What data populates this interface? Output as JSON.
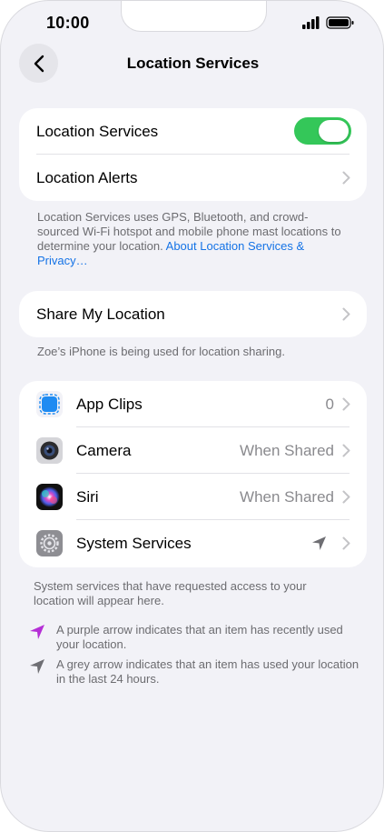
{
  "status_bar": {
    "time": "10:00"
  },
  "nav": {
    "title": "Location Services",
    "back_icon": "chevron-left-icon"
  },
  "location_group": {
    "location_services_label": "Location Services",
    "location_services_enabled": true,
    "location_alerts_label": "Location Alerts"
  },
  "location_footer": {
    "text": "Location Services uses GPS, Bluetooth, and crowd-sourced Wi-Fi hotspot and mobile phone mast locations to determine your location.",
    "link": "About Location Services & Privacy…"
  },
  "share_group": {
    "label": "Share My Location"
  },
  "share_footer": "Zoe’s iPhone is being used for location sharing.",
  "apps": [
    {
      "label": "App Clips",
      "value": "0",
      "icon": "app-clips-icon"
    },
    {
      "label": "Camera",
      "value": "When Shared",
      "icon": "camera-icon"
    },
    {
      "label": "Siri",
      "value": "When Shared",
      "icon": "siri-icon"
    },
    {
      "label": "System Services",
      "value": "",
      "icon": "gear-icon"
    }
  ],
  "apps_footer": "System services that have requested access to your location will appear here.",
  "legend": {
    "purple_text": "A purple arrow indicates that an item has recently used your location.",
    "grey_text": "A grey arrow indicates that an item has used your location in the last 24 hours."
  },
  "colors": {
    "purple_arrow": "#b52fd6",
    "grey_arrow": "#6e6e73",
    "toggle_on": "#34c759",
    "link": "#1573e6"
  }
}
